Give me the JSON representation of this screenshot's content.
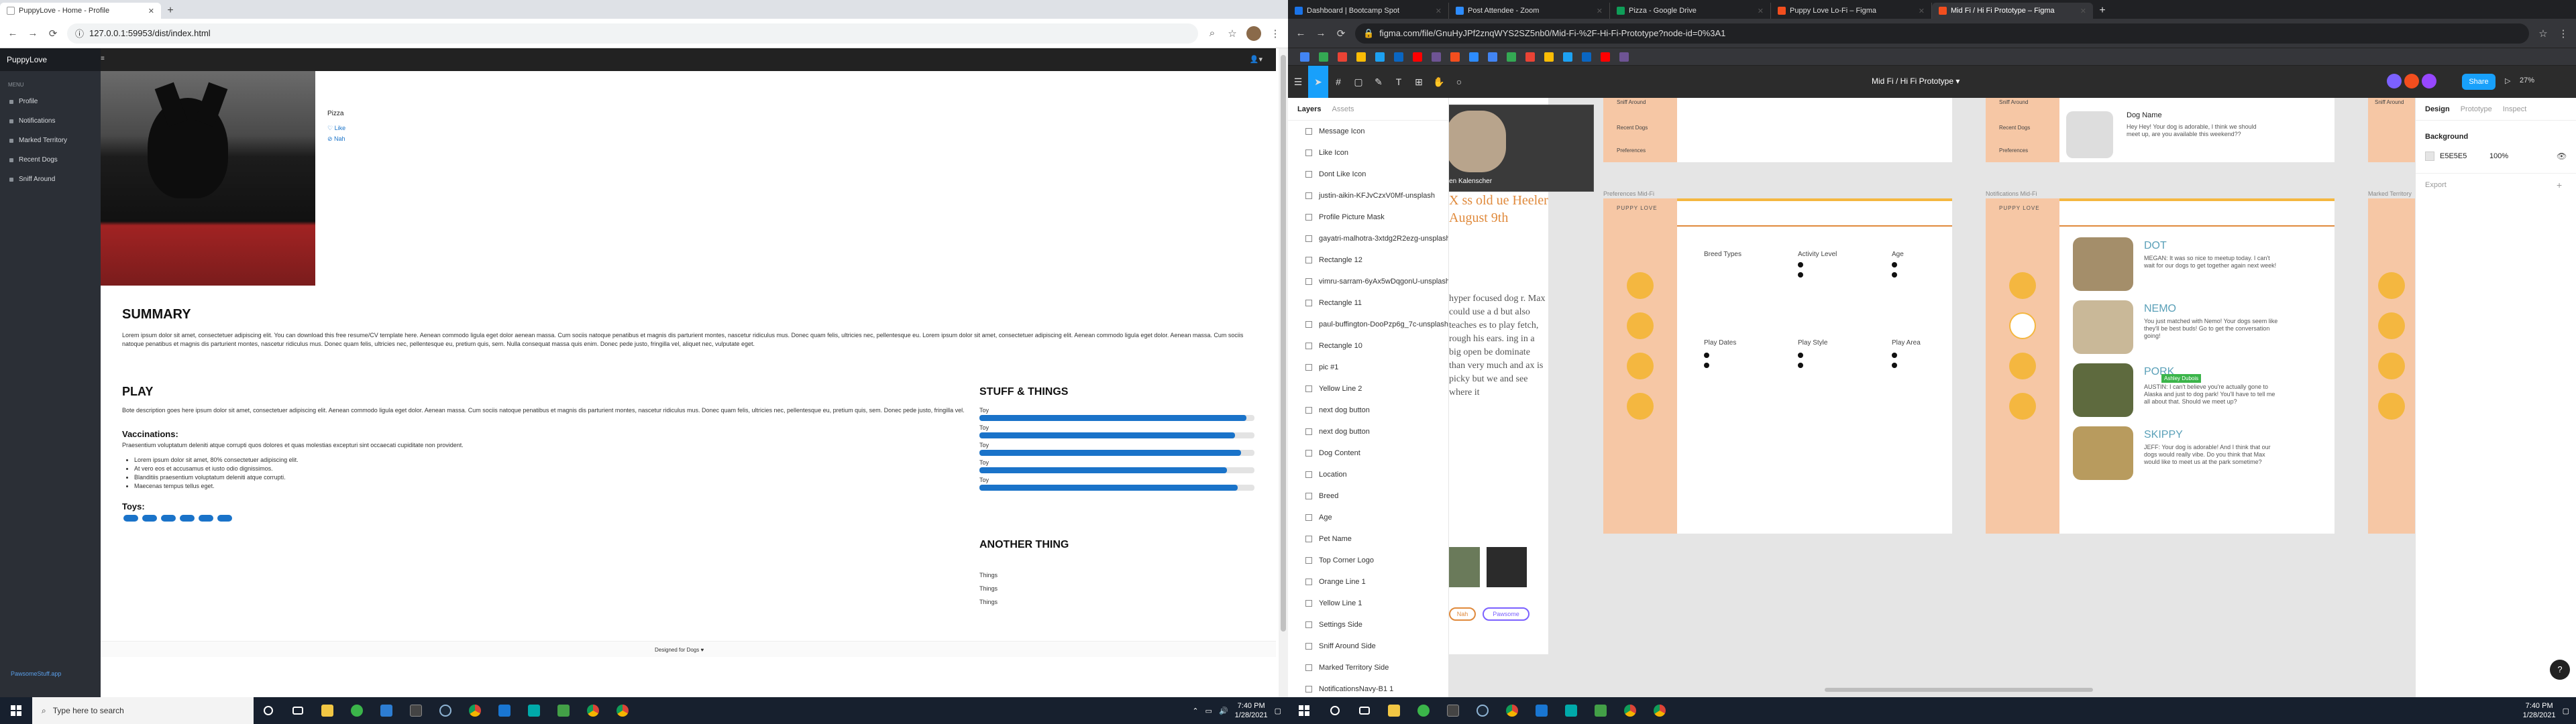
{
  "left_browser": {
    "tabs": [
      {
        "title": "PuppyLove - Home - Profile",
        "active": true
      }
    ],
    "url": "127.0.0.1:59953/dist/index.html"
  },
  "app": {
    "brand": "PuppyLove",
    "menu_label": "MENU",
    "nav": [
      "Profile",
      "Notifications",
      "Marked Territory",
      "Recent Dogs",
      "Sniff Around"
    ],
    "sidebar_footer": "PawsomeStuff.app",
    "profile_name": "Pizza",
    "like": "Like",
    "nah": "Nah",
    "summary_title": "SUMMARY",
    "summary_text": "Lorem ipsum dolor sit amet, consectetuer adipiscing elit. You can download this free resume/CV template here. Aenean commodo ligula eget dolor aenean massa. Cum sociis natoque penatibus et magnis dis parturient montes, nascetur ridiculus mus. Donec quam felis, ultricies nec, pellentesque eu. Lorem ipsum dolor sit amet, consectetuer adipiscing elit. Aenean commodo ligula eget dolor. Aenean massa. Cum sociis natoque penatibus et magnis dis parturient montes, nascetur ridiculus mus. Donec quam felis, ultricies nec, pellentesque eu, pretium quis, sem. Nulla consequat massa quis enim. Donec pede justo, fringilla vel, aliquet nec, vulputate eget.",
    "play_title": "PLAY",
    "play_text": "Bote description goes here ipsum dolor sit amet, consectetuer adipiscing elit. Aenean commodo ligula eget dolor. Aenean massa. Cum sociis natoque penatibus et magnis dis parturient montes, nascetur ridiculus mus. Donec quam felis, ultricies nec, pellentesque eu, pretium quis, sem. Donec pede justo, fringilla vel.",
    "vaccinations_title": "Vaccinations:",
    "vaccinations_text": "Praesentium voluptatum deleniti atque corrupti quos dolores et quas molestias excepturi sint occaecati cupiditate non provident.",
    "vaccination_items": [
      "Lorem ipsum dolor sit amet, 80% consectetuer adipiscing elit.",
      "At vero eos et accusamus et iusto odio dignissimos.",
      "Blanditiis praesentium voluptatum deleniti atque corrupti.",
      "Maecenas tempus tellus eget."
    ],
    "toys_title": "Toys:",
    "toys_count": 6,
    "stuff_title": "STUFF & THINGS",
    "stuff_bars": [
      {
        "label": "Toy",
        "level": 0.97
      },
      {
        "label": "Toy",
        "level": 0.93
      },
      {
        "label": "Toy",
        "level": 0.95
      },
      {
        "label": "Toy",
        "level": 0.9
      },
      {
        "label": "Toy",
        "level": 0.94
      }
    ],
    "another_title": "ANOTHER THING",
    "things": [
      "Things",
      "Things",
      "Things"
    ],
    "footer": "Designed for Dogs ♥"
  },
  "right_browser": {
    "tabs": [
      {
        "title": "Dashboard | Bootcamp Spot",
        "color": "#1a73e8"
      },
      {
        "title": "Post Attendee - Zoom",
        "color": "#2d8cff"
      },
      {
        "title": "Pizza - Google Drive",
        "color": "#0f9d58"
      },
      {
        "title": "Puppy Love Lo-Fi – Figma",
        "color": "#f24e1e"
      },
      {
        "title": "Mid Fi / Hi Fi Prototype – Figma",
        "color": "#f24e1e",
        "active": true
      }
    ],
    "url": "figma.com/file/GnuHyJPf2znqWYS2SZ5nb0/Mid-Fi-%2F-Hi-Fi-Prototype?node-id=0%3A1"
  },
  "figma": {
    "file_title": "Mid Fi / Hi Fi Prototype",
    "share": "Share",
    "zoom": "27%",
    "tabs": [
      "Layers",
      "Assets"
    ],
    "layers": [
      "Message Icon",
      "Like Icon",
      "Dont Like Icon",
      "justin-aikin-KFJvCzxV0Mf-unsplash",
      "Profile Picture Mask",
      "gayatri-malhotra-3xtdg2R2ezg-unsplash",
      "Rectangle 12",
      "vimru-sarram-6yAx5wDqgonU-unsplash",
      "Rectangle 11",
      "paul-buffington-DooPzp6g_7c-unsplash",
      "Rectangle 10",
      "pic #1",
      "Yellow Line 2",
      "next dog button",
      "next dog button",
      "Dog Content",
      "Location",
      "Breed",
      "Age",
      "Pet Name",
      "Top Corner Logo",
      "Orange Line 1",
      "Yellow Line 1",
      "Settings Side",
      "Sniff Around Side",
      "Marked Territory Side",
      "NotificationsNavy-B1 1"
    ],
    "right_tabs": [
      "Design",
      "Prototype",
      "Inspect"
    ],
    "background_label": "Background",
    "bg_hex": "E5E5E5",
    "bg_opacity": "100%",
    "export_label": "Export",
    "zoom_caller": "Ellen Kalenscher",
    "frames": {
      "preferences": "Preferences Mid-Fi",
      "notifications": "Notifications Mid-Fi",
      "marked": "Marked Territory"
    },
    "sidebar_items": [
      "Sniff Around",
      "Recent Dogs",
      "Preferences"
    ],
    "dog_name_label": "Dog Name",
    "dog_message": "Hey Hey! Your dog is adorable, I think we should meet up, are you available this weekend??",
    "pref_headers": [
      "Breed Types",
      "Activity Level",
      "Age",
      "Play Dates",
      "Play Style",
      "Play Area"
    ],
    "notifications": [
      {
        "name": "DOT",
        "text": "MEGAN: It was so nice to meetup today. I can't wait for our dogs to get together again next week!"
      },
      {
        "name": "NEMO",
        "text": "You just matched with Nemo! Your dogs seem like they'll be best buds! Go to get the conversation going!"
      },
      {
        "name": "PORK",
        "text": "AUSTIN: I can't believe you're actually gone to Alaska and just to dog park! You'll have to tell me all about that. Should we meet up?"
      },
      {
        "name": "SKIPPY",
        "text": "JEFF: Your dog is adorable! And I think that our dogs would really vibe. Do you think that Max would like to meet us at the park sometime?"
      }
    ],
    "brand_small": "PUPPY LOVE",
    "side_note": "hyper focused dog r. Max could use a d but also teaches es to play fetch, rough his ears. ing in a big open be dominate than very much and ax is picky but we and see where it",
    "side_big": "X ss old ue Heeler August 9th",
    "buttons_bottom": [
      "Nah",
      "Pawsome"
    ],
    "cursor_label": "Ashley Dubois"
  },
  "taskbar": {
    "search_placeholder": "Type here to search",
    "time": "7:40 PM",
    "date": "1/28/2021"
  }
}
